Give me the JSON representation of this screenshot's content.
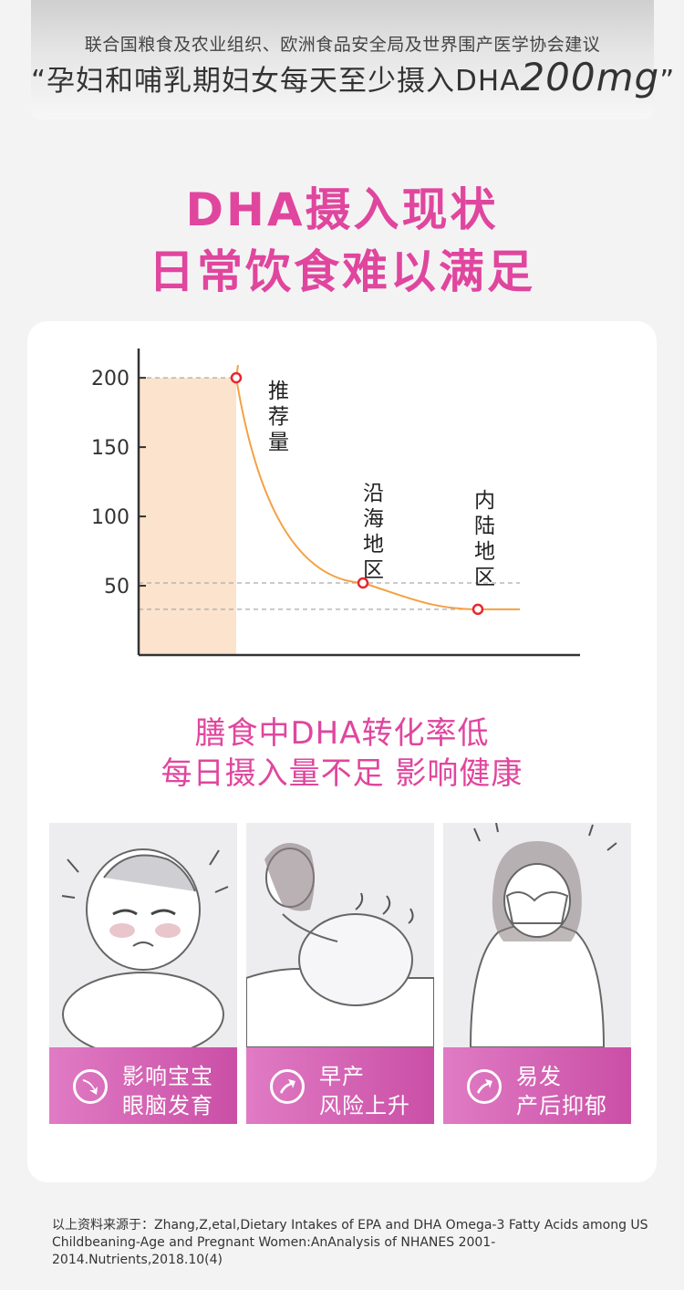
{
  "banner": {
    "line1": "联合国粮食及农业组织、欧洲食品安全局及世界围产医学协会建议",
    "line2_text": "“孕妇和哺乳期妇女每天至少摄入DHA",
    "line2_amount": "200mg",
    "line2_close": "”"
  },
  "headline": {
    "line1": "DHA摄入现状",
    "line2": "日常饮食难以满足"
  },
  "chart_data": {
    "type": "line",
    "y_ticks": [
      200,
      150,
      100,
      50
    ],
    "ylim": [
      0,
      230
    ],
    "grid": false,
    "points": [
      {
        "label": "推荐量",
        "y": 200
      },
      {
        "label": "沿海地区",
        "y": 52
      },
      {
        "label": "内陆地区",
        "y": 33
      }
    ],
    "colors": {
      "curve": "#f5a043",
      "point": "#e5282f",
      "fill": "#fbe3cd",
      "axis": "#333333",
      "guide": "#aaaaaa"
    }
  },
  "subtitle": {
    "line1": "膳食中DHA转化率低",
    "line2": "每日摄入量不足 影响健康"
  },
  "tiles": [
    {
      "line1": "影响宝宝",
      "line2": "眼脑发育",
      "icon": "arrow-down-right-icon"
    },
    {
      "line1": "早产",
      "line2": "风险上升",
      "icon": "arrow-up-right-icon"
    },
    {
      "line1": "易发",
      "line2": "产后抑郁",
      "icon": "arrow-up-right-icon"
    }
  ],
  "source": "以上资料来源于：Zhang,Z,etal,Dietary Intakes of EPA and DHA Omega-3 Fatty Acids among US Childbeaning-Age and Pregnant Women:AnAnalysis of NHANES 2001-2014.Nutrients,2018.10(4)"
}
